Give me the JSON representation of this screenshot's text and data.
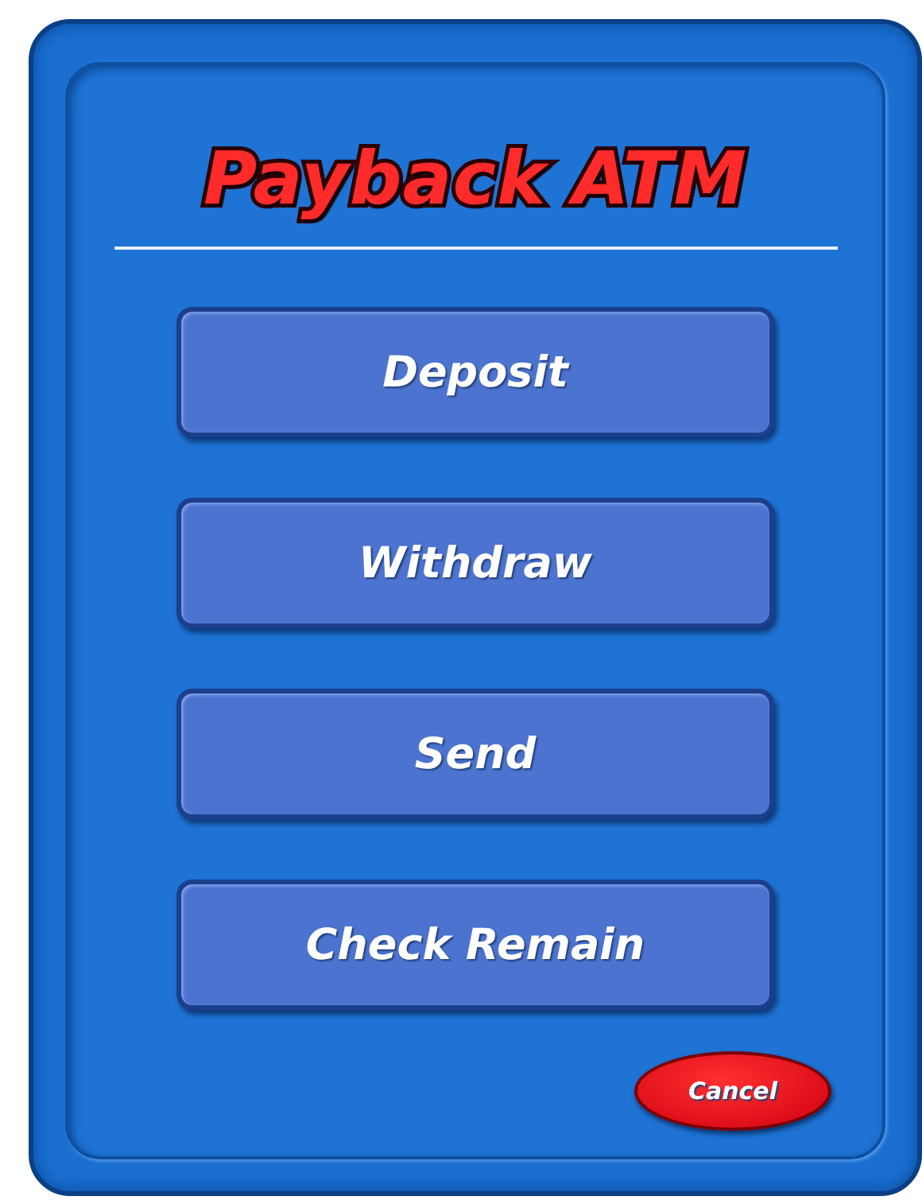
{
  "title": "Payback ATM",
  "buttons": [
    {
      "label": "Deposit"
    },
    {
      "label": "Withdraw"
    },
    {
      "label": "Send"
    },
    {
      "label": "Check Remain"
    }
  ],
  "cancel": {
    "label": "Cancel"
  }
}
